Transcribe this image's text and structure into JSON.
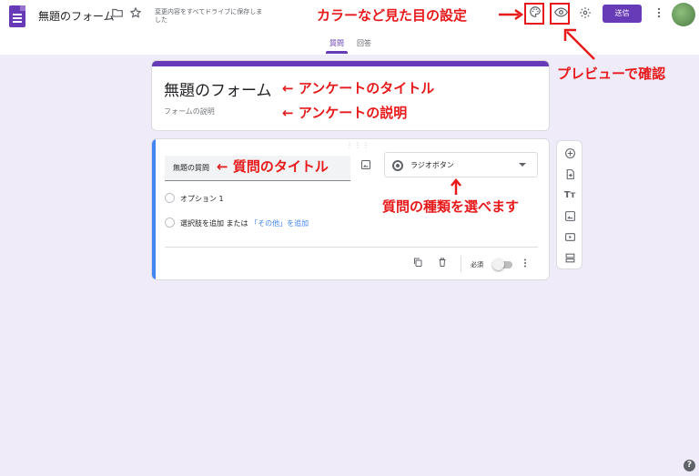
{
  "header": {
    "doc_title": "無題のフォーム",
    "save_status": "変更内容をすべてドライブに保存しました",
    "send_label": "送信",
    "tabs": [
      {
        "label": "質問",
        "active": true
      },
      {
        "label": "回答",
        "active": false
      }
    ],
    "icons": [
      "forms-app-icon",
      "folder-icon",
      "star-icon",
      "palette-icon",
      "eye-icon",
      "gear-icon",
      "more-vert-icon"
    ],
    "accent_color": "#673ab7"
  },
  "form": {
    "title": "無題のフォーム",
    "description": "フォームの説明"
  },
  "question": {
    "title": "無題の質問",
    "type_label": "ラジオボタン",
    "option1": "オプション 1",
    "add_option": "選択肢を追加",
    "or_text": "または",
    "add_other": "「その他」を追加",
    "required_label": "必須"
  },
  "annotations": {
    "theme": "カラーなど見た目の設定",
    "preview": "プレビューで確認",
    "form_title": "アンケートのタイトル",
    "form_desc": "アンケートの説明",
    "question_title": "質問のタイトル",
    "question_type": "質問の種類を選べます",
    "annotation_color": "#e8191a"
  },
  "side_toolbar": {
    "icons": [
      "add-question-icon",
      "import-questions-icon",
      "add-title-icon",
      "add-image-icon",
      "add-video-icon",
      "add-section-icon"
    ]
  },
  "colors": {
    "background": "#f0ebf8",
    "question_accent": "#4285f4"
  }
}
